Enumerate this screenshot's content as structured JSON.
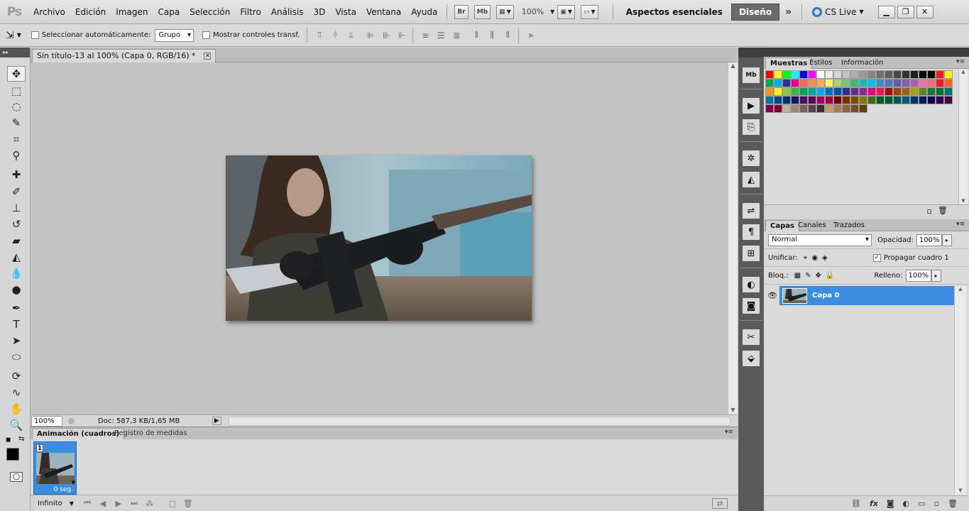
{
  "app": {
    "logo": "Ps",
    "menu": [
      "Archivo",
      "Edición",
      "Imagen",
      "Capa",
      "Selección",
      "Filtro",
      "Análisis",
      "3D",
      "Vista",
      "Ventana",
      "Ayuda"
    ],
    "bridge_btn": "Br",
    "minibridge_btn": "Mb",
    "zoom": "100%",
    "workspace": "Aspectos esenciales",
    "design": "Diseño",
    "cs_live": "CS Live"
  },
  "options": {
    "auto_select_label": "Seleccionar automáticamente:",
    "auto_select_value": "Grupo",
    "show_transform_label": "Mostrar controles transf."
  },
  "document": {
    "tab_title": "Sin título-13 al 100% (Capa 0, RGB/16) *",
    "status_zoom": "100%",
    "status_doc": "Doc: 587,3 KB/1,65 MB"
  },
  "animation": {
    "tab_active": "Animación (cuadros)",
    "tab_inactive": "Registro de medidas",
    "frame_number": "1",
    "frame_delay": "0 seg.",
    "loop": "Infinito"
  },
  "swatches": {
    "tabs": [
      "Muestras",
      "Estilos",
      "Información"
    ],
    "colors": [
      "#ff0000",
      "#ffff00",
      "#00ff00",
      "#00ffff",
      "#0000ff",
      "#ff00ff",
      "#ffffff",
      "#ebebeb",
      "#d6d6d6",
      "#c2c2c2",
      "#adadad",
      "#999999",
      "#858585",
      "#707070",
      "#5c5c5c",
      "#474747",
      "#333333",
      "#1f1f1f",
      "#0a0a0a",
      "#000000",
      "#ee1d24",
      "#fff200",
      "#00a650",
      "#00aeef",
      "#2e3192",
      "#ec008c",
      "#f26c4f",
      "#f68e55",
      "#fbad4b",
      "#fff467",
      "#acd372",
      "#7cc576",
      "#3bb878",
      "#1abbb4",
      "#00bff3",
      "#438cca",
      "#5574b9",
      "#605ca8",
      "#855fa8",
      "#a763a8",
      "#f06ea9",
      "#f26d7d",
      "#ed1c24",
      "#f26522",
      "#f7941d",
      "#fff200",
      "#8dc63f",
      "#39b54a",
      "#00a651",
      "#00a99d",
      "#00aeef",
      "#0072bc",
      "#0054a6",
      "#2e3192",
      "#662d91",
      "#92278f",
      "#ec008c",
      "#ed145b",
      "#9e0b0f",
      "#a0410d",
      "#a3620a",
      "#aba000",
      "#598527",
      "#1a7b30",
      "#007236",
      "#00746b",
      "#0076a3",
      "#004b80",
      "#003471",
      "#1b1464",
      "#440e62",
      "#630460",
      "#9e005d",
      "#9e0039",
      "#790000",
      "#7b2e00",
      "#7d4900",
      "#827b00",
      "#406618",
      "#005e20",
      "#005826",
      "#005952",
      "#005b7f",
      "#003663",
      "#002157",
      "#0d004c",
      "#32004b",
      "#4b0049",
      "#7b0046",
      "#7a0026",
      "#c7b299",
      "#998675",
      "#736357",
      "#534741",
      "#37302a",
      "#c69c6d",
      "#a67c52",
      "#8c6239",
      "#754c24",
      "#603913"
    ]
  },
  "layers": {
    "tabs": [
      "Capas",
      "Canales",
      "Trazados"
    ],
    "blend_mode": "Normal",
    "opacity_label": "Opacidad:",
    "opacity": "100%",
    "unify_label": "Unificar:",
    "propagate_label": "Propagar cuadro 1",
    "lock_label": "Bloq.:",
    "fill_label": "Relleno:",
    "fill": "100%",
    "layer_name": "Capa 0"
  }
}
